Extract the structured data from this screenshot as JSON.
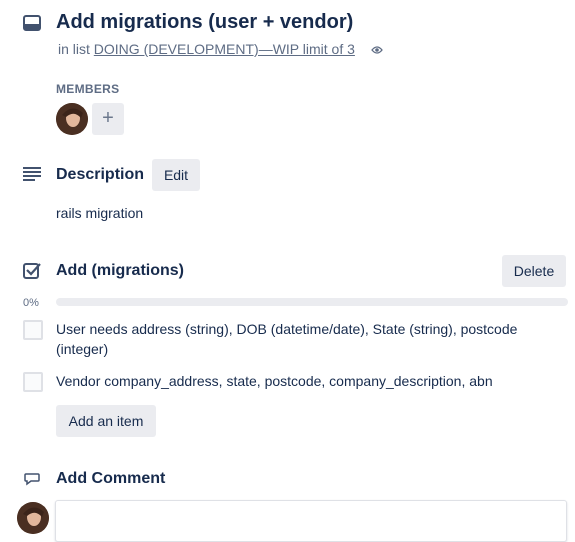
{
  "card": {
    "title": "Add migrations (user + vendor)",
    "in_list_prefix": "in list",
    "list_name": "DOING (DEVELOPMENT)—WIP limit of 3"
  },
  "members": {
    "label": "MEMBERS",
    "add_glyph": "+"
  },
  "description": {
    "heading": "Description",
    "edit_label": "Edit",
    "text": "rails migration"
  },
  "checklist": {
    "title": "Add (migrations)",
    "delete_label": "Delete",
    "progress_percent": 0,
    "progress_text": "0%",
    "items": [
      {
        "text": "User needs address (string), DOB (datetime/date), State (string), postcode (integer)",
        "checked": false
      },
      {
        "text": "Vendor company_address, state, postcode, company_description, abn",
        "checked": false
      }
    ],
    "add_item_label": "Add an item"
  },
  "comment": {
    "heading": "Add Comment"
  },
  "icons": {
    "card": "card-icon",
    "watch": "eye-icon",
    "description": "description-lines-icon",
    "checklist": "checklist-checkbox-icon",
    "comment": "speech-bubble-icon"
  },
  "colors": {
    "text": "#172b4d",
    "subtle": "#5e6c84",
    "button_bg": "#ebecf0",
    "progress": "#5ba4cf"
  }
}
